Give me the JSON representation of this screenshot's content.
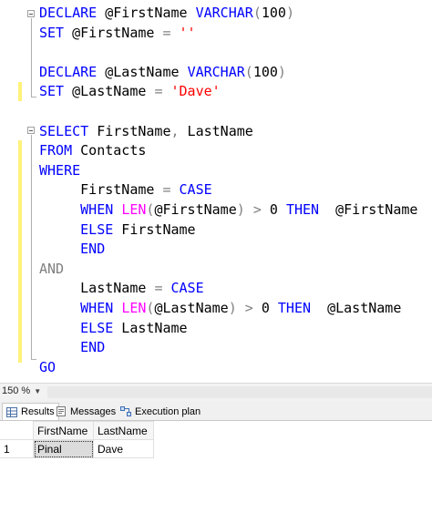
{
  "editor": {
    "lines": [
      [
        {
          "t": "DECLARE",
          "c": "kw"
        },
        {
          "t": " @FirstName ",
          "c": "tx"
        },
        {
          "t": "VARCHAR",
          "c": "kw"
        },
        {
          "t": "(",
          "c": "op"
        },
        {
          "t": "100",
          "c": "tx"
        },
        {
          "t": ")",
          "c": "op"
        }
      ],
      [
        {
          "t": "SET",
          "c": "kw"
        },
        {
          "t": " @FirstName ",
          "c": "tx"
        },
        {
          "t": "=",
          "c": "op"
        },
        {
          "t": " ",
          "c": "tx"
        },
        {
          "t": "''",
          "c": "str"
        }
      ],
      [],
      [
        {
          "t": "DECLARE",
          "c": "kw"
        },
        {
          "t": " @LastName ",
          "c": "tx"
        },
        {
          "t": "VARCHAR",
          "c": "kw"
        },
        {
          "t": "(",
          "c": "op"
        },
        {
          "t": "100",
          "c": "tx"
        },
        {
          "t": ")",
          "c": "op"
        }
      ],
      [
        {
          "t": "SET",
          "c": "kw"
        },
        {
          "t": " @LastName ",
          "c": "tx"
        },
        {
          "t": "=",
          "c": "op"
        },
        {
          "t": " ",
          "c": "tx"
        },
        {
          "t": "'Dave'",
          "c": "str"
        }
      ],
      [],
      [
        {
          "t": "SELECT",
          "c": "kw"
        },
        {
          "t": " FirstName",
          "c": "tx"
        },
        {
          "t": ",",
          "c": "op"
        },
        {
          "t": " LastName",
          "c": "tx"
        }
      ],
      [
        {
          "t": "FROM",
          "c": "kw"
        },
        {
          "t": " Contacts",
          "c": "tx"
        }
      ],
      [
        {
          "t": "WHERE",
          "c": "kw"
        }
      ],
      [
        {
          "t": "     FirstName ",
          "c": "tx"
        },
        {
          "t": "=",
          "c": "op"
        },
        {
          "t": " ",
          "c": "tx"
        },
        {
          "t": "CASE",
          "c": "kw"
        }
      ],
      [
        {
          "t": "     WHEN ",
          "c": "kw"
        },
        {
          "t": "LEN",
          "c": "fn"
        },
        {
          "t": "(",
          "c": "op"
        },
        {
          "t": "@FirstName",
          "c": "tx"
        },
        {
          "t": ")",
          "c": "op"
        },
        {
          "t": " ",
          "c": "tx"
        },
        {
          "t": ">",
          "c": "op"
        },
        {
          "t": " 0 ",
          "c": "tx"
        },
        {
          "t": "THEN",
          "c": "kw"
        },
        {
          "t": "  @FirstName",
          "c": "tx"
        }
      ],
      [
        {
          "t": "     ELSE",
          "c": "kw"
        },
        {
          "t": " FirstName",
          "c": "tx"
        }
      ],
      [
        {
          "t": "     END",
          "c": "kw"
        }
      ],
      [
        {
          "t": "AND",
          "c": "op"
        }
      ],
      [
        {
          "t": "     LastName ",
          "c": "tx"
        },
        {
          "t": "=",
          "c": "op"
        },
        {
          "t": " ",
          "c": "tx"
        },
        {
          "t": "CASE",
          "c": "kw"
        }
      ],
      [
        {
          "t": "     WHEN ",
          "c": "kw"
        },
        {
          "t": "LEN",
          "c": "fn"
        },
        {
          "t": "(",
          "c": "op"
        },
        {
          "t": "@LastName",
          "c": "tx"
        },
        {
          "t": ")",
          "c": "op"
        },
        {
          "t": " ",
          "c": "tx"
        },
        {
          "t": ">",
          "c": "op"
        },
        {
          "t": " 0 ",
          "c": "tx"
        },
        {
          "t": "THEN",
          "c": "kw"
        },
        {
          "t": "  @LastName",
          "c": "tx"
        }
      ],
      [
        {
          "t": "     ELSE",
          "c": "kw"
        },
        {
          "t": " LastName",
          "c": "tx"
        }
      ],
      [
        {
          "t": "     END",
          "c": "kw"
        }
      ],
      [
        {
          "t": "GO",
          "c": "kw"
        }
      ]
    ]
  },
  "statusbar": {
    "zoom": "150 %"
  },
  "tabs": [
    {
      "label": "Results",
      "icon": "grid-icon",
      "active": true
    },
    {
      "label": "Messages",
      "icon": "messages-icon",
      "active": false
    },
    {
      "label": "Execution plan",
      "icon": "execution-plan-icon",
      "active": false
    }
  ],
  "results": {
    "columns": [
      "FirstName",
      "LastName"
    ],
    "rows": [
      {
        "num": "1",
        "cells": [
          "Pinal",
          "Dave"
        ]
      }
    ]
  }
}
